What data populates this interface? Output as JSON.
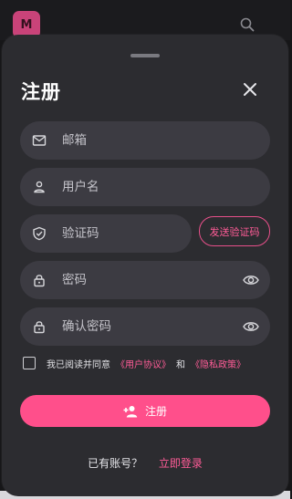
{
  "background": {
    "logo_text": "M"
  },
  "sheet": {
    "title": "注册",
    "fields": {
      "email": {
        "placeholder": "邮箱",
        "icon": "mail-icon"
      },
      "username": {
        "placeholder": "用户名",
        "icon": "person-icon"
      },
      "code": {
        "placeholder": "验证码",
        "icon": "shield-icon"
      },
      "password": {
        "placeholder": "密码",
        "icon": "lock-icon"
      },
      "confirm_password": {
        "placeholder": "确认密码",
        "icon": "lock-icon"
      }
    },
    "send_code_label": "发送验证码",
    "agreement": {
      "prefix": "我已阅读并同意",
      "user_agreement": "《用户协议》",
      "and": "和",
      "privacy_policy": "《隐私政策》"
    },
    "register_label": "注册",
    "login_prompt": "已有账号？",
    "login_link": "立即登录"
  },
  "colors": {
    "accent": "#ff4f8b",
    "sheet_bg": "#2c2c30",
    "field_bg": "#3c3b42"
  }
}
